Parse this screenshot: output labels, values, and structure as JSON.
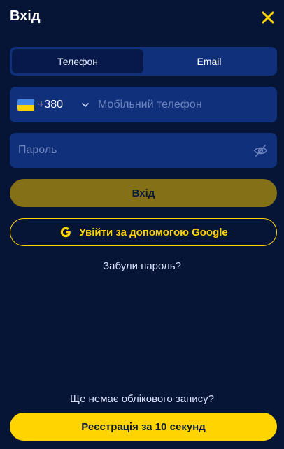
{
  "header": {
    "title": "Вхід"
  },
  "icons": {
    "close": "close-icon",
    "eye": "eye-off-icon",
    "google": "google-icon",
    "chevron": "chevron-down-icon"
  },
  "tabs": [
    {
      "label": "Телефон",
      "active": true
    },
    {
      "label": "Email",
      "active": false
    }
  ],
  "phone": {
    "country_code": "+380",
    "placeholder": "Мобільний телефон",
    "value": ""
  },
  "password": {
    "placeholder": "Пароль",
    "value": ""
  },
  "buttons": {
    "login": "Вхід",
    "google": "Увійти за допомогою Google",
    "forgot": "Забули пароль?",
    "register": "Реєстрація за 10 секунд"
  },
  "footer": {
    "no_account": "Ще немає облікового запису?"
  },
  "colors": {
    "background": "#061435",
    "field": "#10307c",
    "accent": "#ffd400",
    "login_disabled": "#847117"
  }
}
